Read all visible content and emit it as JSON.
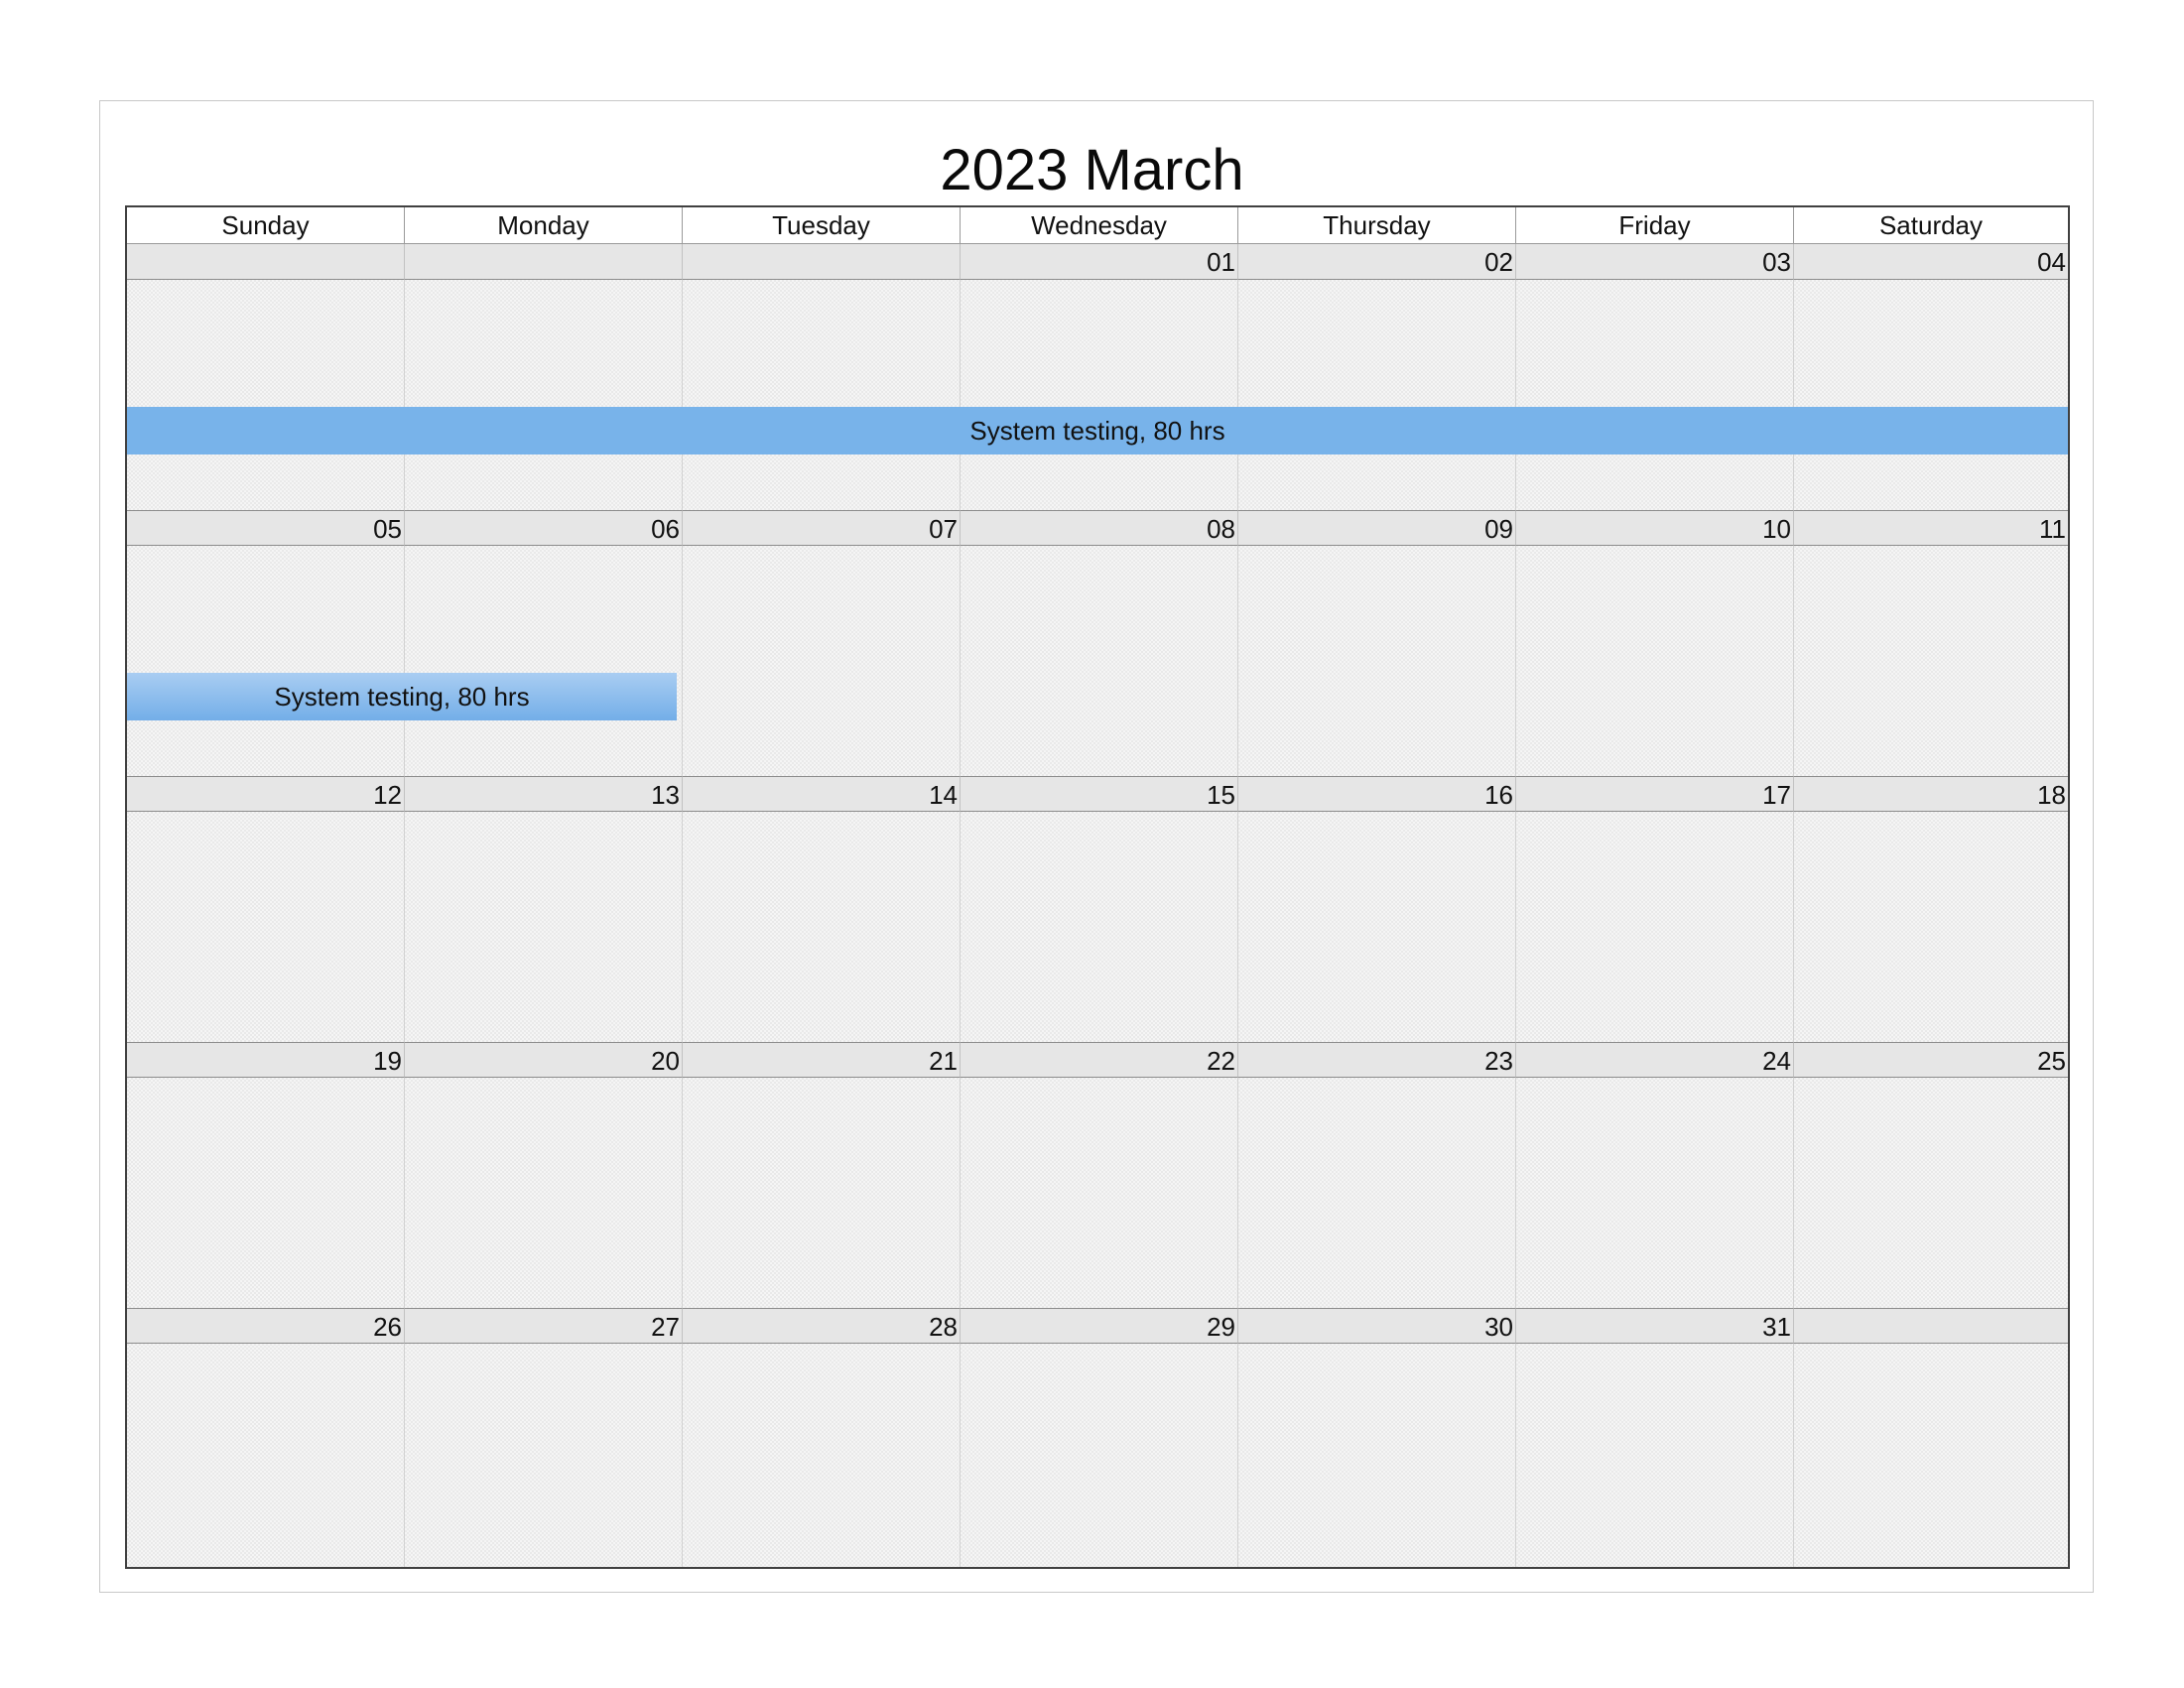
{
  "calendar": {
    "title": "2023 March",
    "weekdays": [
      "Sunday",
      "Monday",
      "Tuesday",
      "Wednesday",
      "Thursday",
      "Friday",
      "Saturday"
    ],
    "weeks": [
      [
        "",
        "",
        "",
        "01",
        "02",
        "03",
        "04"
      ],
      [
        "05",
        "06",
        "07",
        "08",
        "09",
        "10",
        "11"
      ],
      [
        "12",
        "13",
        "14",
        "15",
        "16",
        "17",
        "18"
      ],
      [
        "19",
        "20",
        "21",
        "22",
        "23",
        "24",
        "25"
      ],
      [
        "26",
        "27",
        "28",
        "29",
        "30",
        "31",
        ""
      ]
    ],
    "events": [
      {
        "label": "System testing, 80 hrs",
        "week": 0,
        "start_day": 0,
        "span_days": 7,
        "color": "#78b3ea",
        "style": "full"
      },
      {
        "label": "System testing, 80 hrs",
        "week": 1,
        "start_day": 0,
        "span_days": 2,
        "color": "#73aee8",
        "style": "partial"
      }
    ],
    "colors": {
      "date_bar": "#e6e6e6",
      "cell_body": "#e9e9e9",
      "border": "#404040"
    }
  }
}
